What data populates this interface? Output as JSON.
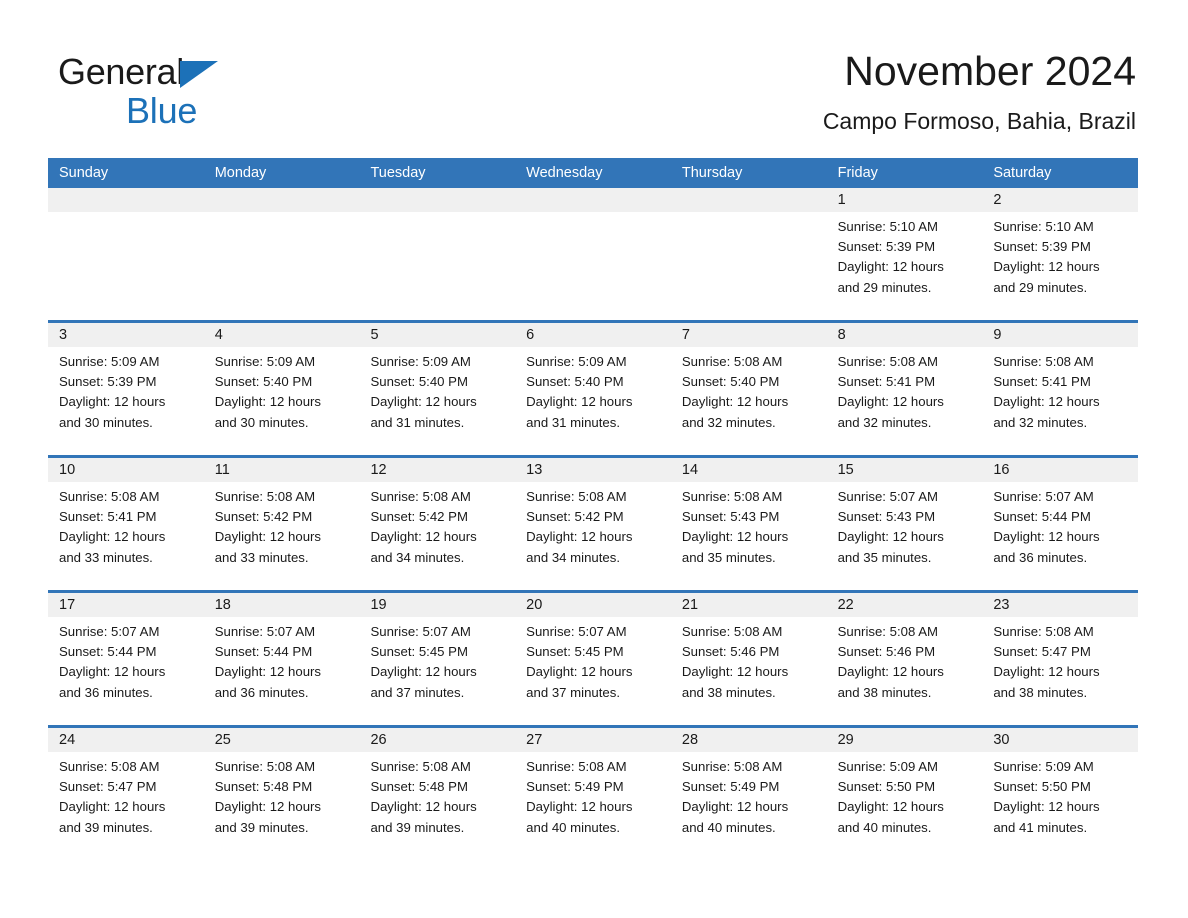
{
  "brand": {
    "name_part1": "General",
    "name_part2": "Blue",
    "triangle_icon": "triangle-icon",
    "accent_color": "#1c71b8"
  },
  "header": {
    "title": "November 2024",
    "location": "Campo Formoso, Bahia, Brazil"
  },
  "theme": {
    "header_blue": "#3275b8",
    "day_band_gray": "#f0f0f0",
    "text_color": "#1a1a1a"
  },
  "weekdays": [
    "Sunday",
    "Monday",
    "Tuesday",
    "Wednesday",
    "Thursday",
    "Friday",
    "Saturday"
  ],
  "weeks": [
    [
      {
        "day": "",
        "sunrise": "",
        "sunset": "",
        "daylight": "",
        "daylight2": ""
      },
      {
        "day": "",
        "sunrise": "",
        "sunset": "",
        "daylight": "",
        "daylight2": ""
      },
      {
        "day": "",
        "sunrise": "",
        "sunset": "",
        "daylight": "",
        "daylight2": ""
      },
      {
        "day": "",
        "sunrise": "",
        "sunset": "",
        "daylight": "",
        "daylight2": ""
      },
      {
        "day": "",
        "sunrise": "",
        "sunset": "",
        "daylight": "",
        "daylight2": ""
      },
      {
        "day": "1",
        "sunrise": "Sunrise: 5:10 AM",
        "sunset": "Sunset: 5:39 PM",
        "daylight": "Daylight: 12 hours",
        "daylight2": "and 29 minutes."
      },
      {
        "day": "2",
        "sunrise": "Sunrise: 5:10 AM",
        "sunset": "Sunset: 5:39 PM",
        "daylight": "Daylight: 12 hours",
        "daylight2": "and 29 minutes."
      }
    ],
    [
      {
        "day": "3",
        "sunrise": "Sunrise: 5:09 AM",
        "sunset": "Sunset: 5:39 PM",
        "daylight": "Daylight: 12 hours",
        "daylight2": "and 30 minutes."
      },
      {
        "day": "4",
        "sunrise": "Sunrise: 5:09 AM",
        "sunset": "Sunset: 5:40 PM",
        "daylight": "Daylight: 12 hours",
        "daylight2": "and 30 minutes."
      },
      {
        "day": "5",
        "sunrise": "Sunrise: 5:09 AM",
        "sunset": "Sunset: 5:40 PM",
        "daylight": "Daylight: 12 hours",
        "daylight2": "and 31 minutes."
      },
      {
        "day": "6",
        "sunrise": "Sunrise: 5:09 AM",
        "sunset": "Sunset: 5:40 PM",
        "daylight": "Daylight: 12 hours",
        "daylight2": "and 31 minutes."
      },
      {
        "day": "7",
        "sunrise": "Sunrise: 5:08 AM",
        "sunset": "Sunset: 5:40 PM",
        "daylight": "Daylight: 12 hours",
        "daylight2": "and 32 minutes."
      },
      {
        "day": "8",
        "sunrise": "Sunrise: 5:08 AM",
        "sunset": "Sunset: 5:41 PM",
        "daylight": "Daylight: 12 hours",
        "daylight2": "and 32 minutes."
      },
      {
        "day": "9",
        "sunrise": "Sunrise: 5:08 AM",
        "sunset": "Sunset: 5:41 PM",
        "daylight": "Daylight: 12 hours",
        "daylight2": "and 32 minutes."
      }
    ],
    [
      {
        "day": "10",
        "sunrise": "Sunrise: 5:08 AM",
        "sunset": "Sunset: 5:41 PM",
        "daylight": "Daylight: 12 hours",
        "daylight2": "and 33 minutes."
      },
      {
        "day": "11",
        "sunrise": "Sunrise: 5:08 AM",
        "sunset": "Sunset: 5:42 PM",
        "daylight": "Daylight: 12 hours",
        "daylight2": "and 33 minutes."
      },
      {
        "day": "12",
        "sunrise": "Sunrise: 5:08 AM",
        "sunset": "Sunset: 5:42 PM",
        "daylight": "Daylight: 12 hours",
        "daylight2": "and 34 minutes."
      },
      {
        "day": "13",
        "sunrise": "Sunrise: 5:08 AM",
        "sunset": "Sunset: 5:42 PM",
        "daylight": "Daylight: 12 hours",
        "daylight2": "and 34 minutes."
      },
      {
        "day": "14",
        "sunrise": "Sunrise: 5:08 AM",
        "sunset": "Sunset: 5:43 PM",
        "daylight": "Daylight: 12 hours",
        "daylight2": "and 35 minutes."
      },
      {
        "day": "15",
        "sunrise": "Sunrise: 5:07 AM",
        "sunset": "Sunset: 5:43 PM",
        "daylight": "Daylight: 12 hours",
        "daylight2": "and 35 minutes."
      },
      {
        "day": "16",
        "sunrise": "Sunrise: 5:07 AM",
        "sunset": "Sunset: 5:44 PM",
        "daylight": "Daylight: 12 hours",
        "daylight2": "and 36 minutes."
      }
    ],
    [
      {
        "day": "17",
        "sunrise": "Sunrise: 5:07 AM",
        "sunset": "Sunset: 5:44 PM",
        "daylight": "Daylight: 12 hours",
        "daylight2": "and 36 minutes."
      },
      {
        "day": "18",
        "sunrise": "Sunrise: 5:07 AM",
        "sunset": "Sunset: 5:44 PM",
        "daylight": "Daylight: 12 hours",
        "daylight2": "and 36 minutes."
      },
      {
        "day": "19",
        "sunrise": "Sunrise: 5:07 AM",
        "sunset": "Sunset: 5:45 PM",
        "daylight": "Daylight: 12 hours",
        "daylight2": "and 37 minutes."
      },
      {
        "day": "20",
        "sunrise": "Sunrise: 5:07 AM",
        "sunset": "Sunset: 5:45 PM",
        "daylight": "Daylight: 12 hours",
        "daylight2": "and 37 minutes."
      },
      {
        "day": "21",
        "sunrise": "Sunrise: 5:08 AM",
        "sunset": "Sunset: 5:46 PM",
        "daylight": "Daylight: 12 hours",
        "daylight2": "and 38 minutes."
      },
      {
        "day": "22",
        "sunrise": "Sunrise: 5:08 AM",
        "sunset": "Sunset: 5:46 PM",
        "daylight": "Daylight: 12 hours",
        "daylight2": "and 38 minutes."
      },
      {
        "day": "23",
        "sunrise": "Sunrise: 5:08 AM",
        "sunset": "Sunset: 5:47 PM",
        "daylight": "Daylight: 12 hours",
        "daylight2": "and 38 minutes."
      }
    ],
    [
      {
        "day": "24",
        "sunrise": "Sunrise: 5:08 AM",
        "sunset": "Sunset: 5:47 PM",
        "daylight": "Daylight: 12 hours",
        "daylight2": "and 39 minutes."
      },
      {
        "day": "25",
        "sunrise": "Sunrise: 5:08 AM",
        "sunset": "Sunset: 5:48 PM",
        "daylight": "Daylight: 12 hours",
        "daylight2": "and 39 minutes."
      },
      {
        "day": "26",
        "sunrise": "Sunrise: 5:08 AM",
        "sunset": "Sunset: 5:48 PM",
        "daylight": "Daylight: 12 hours",
        "daylight2": "and 39 minutes."
      },
      {
        "day": "27",
        "sunrise": "Sunrise: 5:08 AM",
        "sunset": "Sunset: 5:49 PM",
        "daylight": "Daylight: 12 hours",
        "daylight2": "and 40 minutes."
      },
      {
        "day": "28",
        "sunrise": "Sunrise: 5:08 AM",
        "sunset": "Sunset: 5:49 PM",
        "daylight": "Daylight: 12 hours",
        "daylight2": "and 40 minutes."
      },
      {
        "day": "29",
        "sunrise": "Sunrise: 5:09 AM",
        "sunset": "Sunset: 5:50 PM",
        "daylight": "Daylight: 12 hours",
        "daylight2": "and 40 minutes."
      },
      {
        "day": "30",
        "sunrise": "Sunrise: 5:09 AM",
        "sunset": "Sunset: 5:50 PM",
        "daylight": "Daylight: 12 hours",
        "daylight2": "and 41 minutes."
      }
    ]
  ]
}
